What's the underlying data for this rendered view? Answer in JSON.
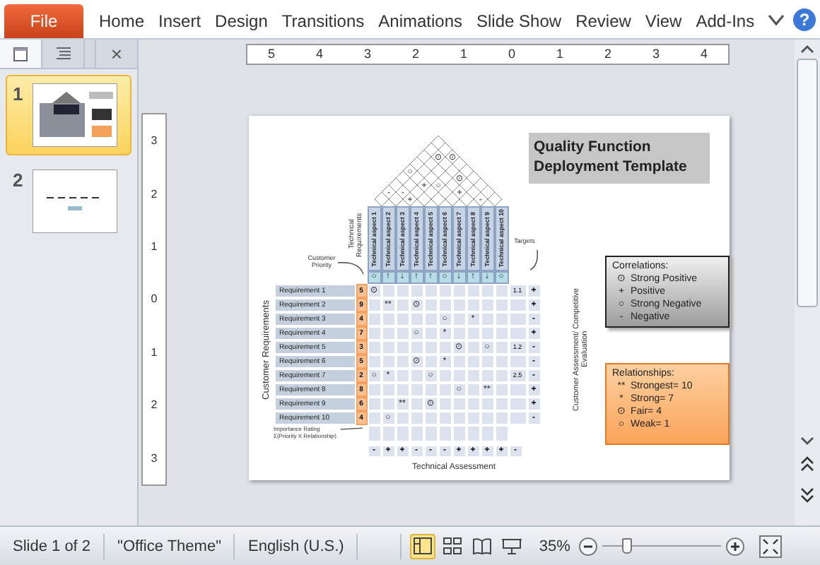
{
  "ribbon": {
    "tabs": [
      {
        "label": "File",
        "kind": "file"
      },
      {
        "label": "Home",
        "kind": "tab"
      },
      {
        "label": "Insert",
        "kind": "tab"
      },
      {
        "label": "Design",
        "kind": "tab"
      },
      {
        "label": "Transitions",
        "kind": "tab"
      },
      {
        "label": "Animations",
        "kind": "tab"
      },
      {
        "label": "Slide Show",
        "kind": "tab"
      },
      {
        "label": "Review",
        "kind": "tab"
      },
      {
        "label": "View",
        "kind": "tab"
      },
      {
        "label": "Add-Ins",
        "kind": "tab"
      }
    ],
    "help": "?"
  },
  "panel": {
    "tabs": [
      {
        "kind": "slides",
        "selected": true
      },
      {
        "kind": "outline",
        "selected": false
      }
    ],
    "close": "×",
    "slides": [
      {
        "number": "1",
        "selected": true
      },
      {
        "number": "2",
        "selected": false
      }
    ]
  },
  "rulers": {
    "horizontal": [
      "5",
      "4",
      "3",
      "2",
      "1",
      "0",
      "1",
      "2",
      "3",
      "4"
    ],
    "vertical": [
      "3",
      "2",
      "1",
      "0",
      "1",
      "2",
      "3"
    ]
  },
  "slide": {
    "title": "Quality Function Deployment Template",
    "customer_priority_label": "Customer Priority",
    "technical_requirements_label": "Technical Requirements",
    "targets_label": "Targets",
    "customer_requirements_label": "Customer Requirements",
    "competitive_label": "Customer Assessment/ Competitive Evaluation",
    "importance_label": "Importance Rating Σ(Priority X Relationship)",
    "technical_assessment_label": "Technical Assessment",
    "roof": [
      [
        {
          "kind": "blank"
        }
      ],
      [
        {
          "kind": "blank"
        },
        {
          "kind": "blank"
        }
      ],
      [
        {
          "kind": "blank"
        },
        {
          "kind": "mark",
          "symbol": "⊙"
        },
        {
          "kind": "mark",
          "symbol": "⊙"
        }
      ],
      [
        {
          "kind": "blank"
        },
        {
          "kind": "blank"
        },
        {
          "kind": "blank"
        },
        {
          "kind": "blank"
        }
      ],
      [
        {
          "kind": "mark",
          "symbol": "○"
        },
        {
          "kind": "blank"
        },
        {
          "kind": "blank"
        },
        {
          "kind": "blank"
        },
        {
          "kind": "blank"
        }
      ],
      [
        {
          "kind": "blank"
        },
        {
          "kind": "blank"
        },
        {
          "kind": "blank"
        },
        {
          "kind": "blank"
        },
        {
          "kind": "mark",
          "symbol": "⊙"
        },
        {
          "kind": "blank"
        }
      ],
      [
        {
          "kind": "blank"
        },
        {
          "kind": "blank"
        },
        {
          "kind": "mark",
          "symbol": "+"
        },
        {
          "kind": "mark",
          "symbol": "○"
        },
        {
          "kind": "blank"
        },
        {
          "kind": "blank"
        },
        {
          "kind": "blank"
        }
      ],
      [
        {
          "kind": "mark",
          "symbol": "-"
        },
        {
          "kind": "mark",
          "symbol": "-"
        },
        {
          "kind": "blank"
        },
        {
          "kind": "blank"
        },
        {
          "kind": "blank"
        },
        {
          "kind": "mark",
          "symbol": "+"
        },
        {
          "kind": "blank"
        },
        {
          "kind": "blank"
        }
      ],
      [
        {
          "kind": "blank"
        },
        {
          "kind": "blank"
        },
        {
          "kind": "mark",
          "symbol": "+"
        },
        {
          "kind": "blank"
        },
        {
          "kind": "blank"
        },
        {
          "kind": "blank"
        },
        {
          "kind": "blank"
        },
        {
          "kind": "mark",
          "symbol": "-"
        },
        {
          "kind": "blank"
        }
      ]
    ],
    "technical_aspects": [
      {
        "label": "Technical aspect 1",
        "direction": "○"
      },
      {
        "label": "Technical aspect 2",
        "direction": "↑"
      },
      {
        "label": "Technical aspect 3",
        "direction": "↓"
      },
      {
        "label": "Technical aspect 4",
        "direction": "↑"
      },
      {
        "label": "Technical aspect 5",
        "direction": "↑"
      },
      {
        "label": "Technical aspect 6",
        "direction": "○"
      },
      {
        "label": "Technical aspect 7",
        "direction": "↓"
      },
      {
        "label": "Technical aspect 8",
        "direction": "↑"
      },
      {
        "label": "Technical aspect 9",
        "direction": "↓"
      },
      {
        "label": "Technical aspect 10",
        "direction": "○"
      }
    ],
    "requirements": [
      {
        "name": "Requirement 1",
        "priority": "5",
        "cells": [
          {
            "kind": "mark",
            "symbol": "⊙"
          },
          {
            "kind": "blank"
          },
          {
            "kind": "blank"
          },
          {
            "kind": "blank"
          },
          {
            "kind": "blank"
          },
          {
            "kind": "blank"
          },
          {
            "kind": "blank"
          },
          {
            "kind": "blank"
          },
          {
            "kind": "blank"
          },
          {
            "kind": "blank"
          }
        ],
        "target": "1.1",
        "assessment": "+"
      },
      {
        "name": "Requirement 2",
        "priority": "9",
        "cells": [
          {
            "kind": "blank"
          },
          {
            "kind": "mark",
            "symbol": "**"
          },
          {
            "kind": "blank"
          },
          {
            "kind": "mark",
            "symbol": "⊙"
          },
          {
            "kind": "blank"
          },
          {
            "kind": "blank"
          },
          {
            "kind": "blank"
          },
          {
            "kind": "blank"
          },
          {
            "kind": "blank"
          },
          {
            "kind": "blank"
          }
        ],
        "assessment": "+"
      },
      {
        "name": "Requirement 3",
        "priority": "4",
        "cells": [
          {
            "kind": "blank"
          },
          {
            "kind": "blank"
          },
          {
            "kind": "blank"
          },
          {
            "kind": "blank"
          },
          {
            "kind": "blank"
          },
          {
            "kind": "mark",
            "symbol": "○"
          },
          {
            "kind": "blank"
          },
          {
            "kind": "mark",
            "symbol": "*"
          },
          {
            "kind": "blank"
          },
          {
            "kind": "blank"
          }
        ],
        "assessment": "-"
      },
      {
        "name": "Requirement 4",
        "priority": "7",
        "cells": [
          {
            "kind": "blank"
          },
          {
            "kind": "blank"
          },
          {
            "kind": "blank"
          },
          {
            "kind": "mark",
            "symbol": "○"
          },
          {
            "kind": "blank"
          },
          {
            "kind": "mark",
            "symbol": "*"
          },
          {
            "kind": "blank"
          },
          {
            "kind": "blank"
          },
          {
            "kind": "blank"
          },
          {
            "kind": "blank"
          }
        ],
        "assessment": "+"
      },
      {
        "name": "Requirement 5",
        "priority": "3",
        "cells": [
          {
            "kind": "blank"
          },
          {
            "kind": "blank"
          },
          {
            "kind": "blank"
          },
          {
            "kind": "blank"
          },
          {
            "kind": "blank"
          },
          {
            "kind": "blank"
          },
          {
            "kind": "mark",
            "symbol": "⊙"
          },
          {
            "kind": "blank"
          },
          {
            "kind": "mark",
            "symbol": "○"
          },
          {
            "kind": "blank"
          }
        ],
        "target": "1.2",
        "assessment": "-"
      },
      {
        "name": "Requirement 6",
        "priority": "5",
        "cells": [
          {
            "kind": "blank"
          },
          {
            "kind": "blank"
          },
          {
            "kind": "blank"
          },
          {
            "kind": "mark",
            "symbol": "⊙"
          },
          {
            "kind": "blank"
          },
          {
            "kind": "mark",
            "symbol": "*"
          },
          {
            "kind": "blank"
          },
          {
            "kind": "blank"
          },
          {
            "kind": "blank"
          },
          {
            "kind": "blank"
          }
        ],
        "assessment": "-"
      },
      {
        "name": "Requirement 7",
        "priority": "2",
        "cells": [
          {
            "kind": "mark",
            "symbol": "○"
          },
          {
            "kind": "mark",
            "symbol": "*"
          },
          {
            "kind": "blank"
          },
          {
            "kind": "blank"
          },
          {
            "kind": "mark",
            "symbol": "○"
          },
          {
            "kind": "blank"
          },
          {
            "kind": "blank"
          },
          {
            "kind": "blank"
          },
          {
            "kind": "blank"
          },
          {
            "kind": "blank"
          }
        ],
        "target": "2.5",
        "assessment": "-"
      },
      {
        "name": "Requirement 8",
        "priority": "8",
        "cells": [
          {
            "kind": "blank"
          },
          {
            "kind": "blank"
          },
          {
            "kind": "blank"
          },
          {
            "kind": "blank"
          },
          {
            "kind": "blank"
          },
          {
            "kind": "blank"
          },
          {
            "kind": "mark",
            "symbol": "○"
          },
          {
            "kind": "blank"
          },
          {
            "kind": "mark",
            "symbol": "**"
          },
          {
            "kind": "blank"
          }
        ],
        "assessment": "+"
      },
      {
        "name": "Requirement 9",
        "priority": "6",
        "cells": [
          {
            "kind": "blank"
          },
          {
            "kind": "blank"
          },
          {
            "kind": "mark",
            "symbol": "**"
          },
          {
            "kind": "blank"
          },
          {
            "kind": "mark",
            "symbol": "⊙"
          },
          {
            "kind": "blank"
          },
          {
            "kind": "blank"
          },
          {
            "kind": "blank"
          },
          {
            "kind": "blank"
          },
          {
            "kind": "blank"
          }
        ],
        "assessment": "+"
      },
      {
        "name": "Requirement 10",
        "priority": "4",
        "cells": [
          {
            "kind": "blank"
          },
          {
            "kind": "mark",
            "symbol": "○"
          },
          {
            "kind": "blank"
          },
          {
            "kind": "blank"
          },
          {
            "kind": "blank"
          },
          {
            "kind": "blank"
          },
          {
            "kind": "blank"
          },
          {
            "kind": "blank"
          },
          {
            "kind": "blank"
          },
          {
            "kind": "blank"
          }
        ],
        "assessment": "-"
      }
    ],
    "technical_assessment": [
      "-",
      "+",
      "+",
      "-",
      "-",
      "-",
      "+",
      "+",
      "+",
      "+",
      "-"
    ],
    "correlations_legend": {
      "title": "Correlations:",
      "items": [
        {
          "symbol": "⊙",
          "label": "Strong Positive"
        },
        {
          "symbol": "+",
          "label": "Positive"
        },
        {
          "symbol": "○",
          "label": "Strong Negative"
        },
        {
          "symbol": "-",
          "label": "Negative"
        }
      ]
    },
    "relationships_legend": {
      "title": "Relationships:",
      "items": [
        {
          "symbol": "**",
          "label": "Strongest= 10"
        },
        {
          "symbol": "*",
          "label": "Strong= 7"
        },
        {
          "symbol": "⊙",
          "label": "Fair= 4"
        },
        {
          "symbol": "○",
          "label": "Weak= 1"
        }
      ]
    }
  },
  "status_bar": {
    "slide": "Slide 1 of 2",
    "theme": "\"Office Theme\"",
    "language": "English (U.S.)",
    "views": [
      {
        "kind": "normal",
        "selected": true
      },
      {
        "kind": "sorter",
        "selected": false
      },
      {
        "kind": "reading",
        "selected": false
      },
      {
        "kind": "slideshow",
        "selected": false
      }
    ],
    "zoom": "35%",
    "zoom_slider": {
      "level": 0.2
    }
  }
}
